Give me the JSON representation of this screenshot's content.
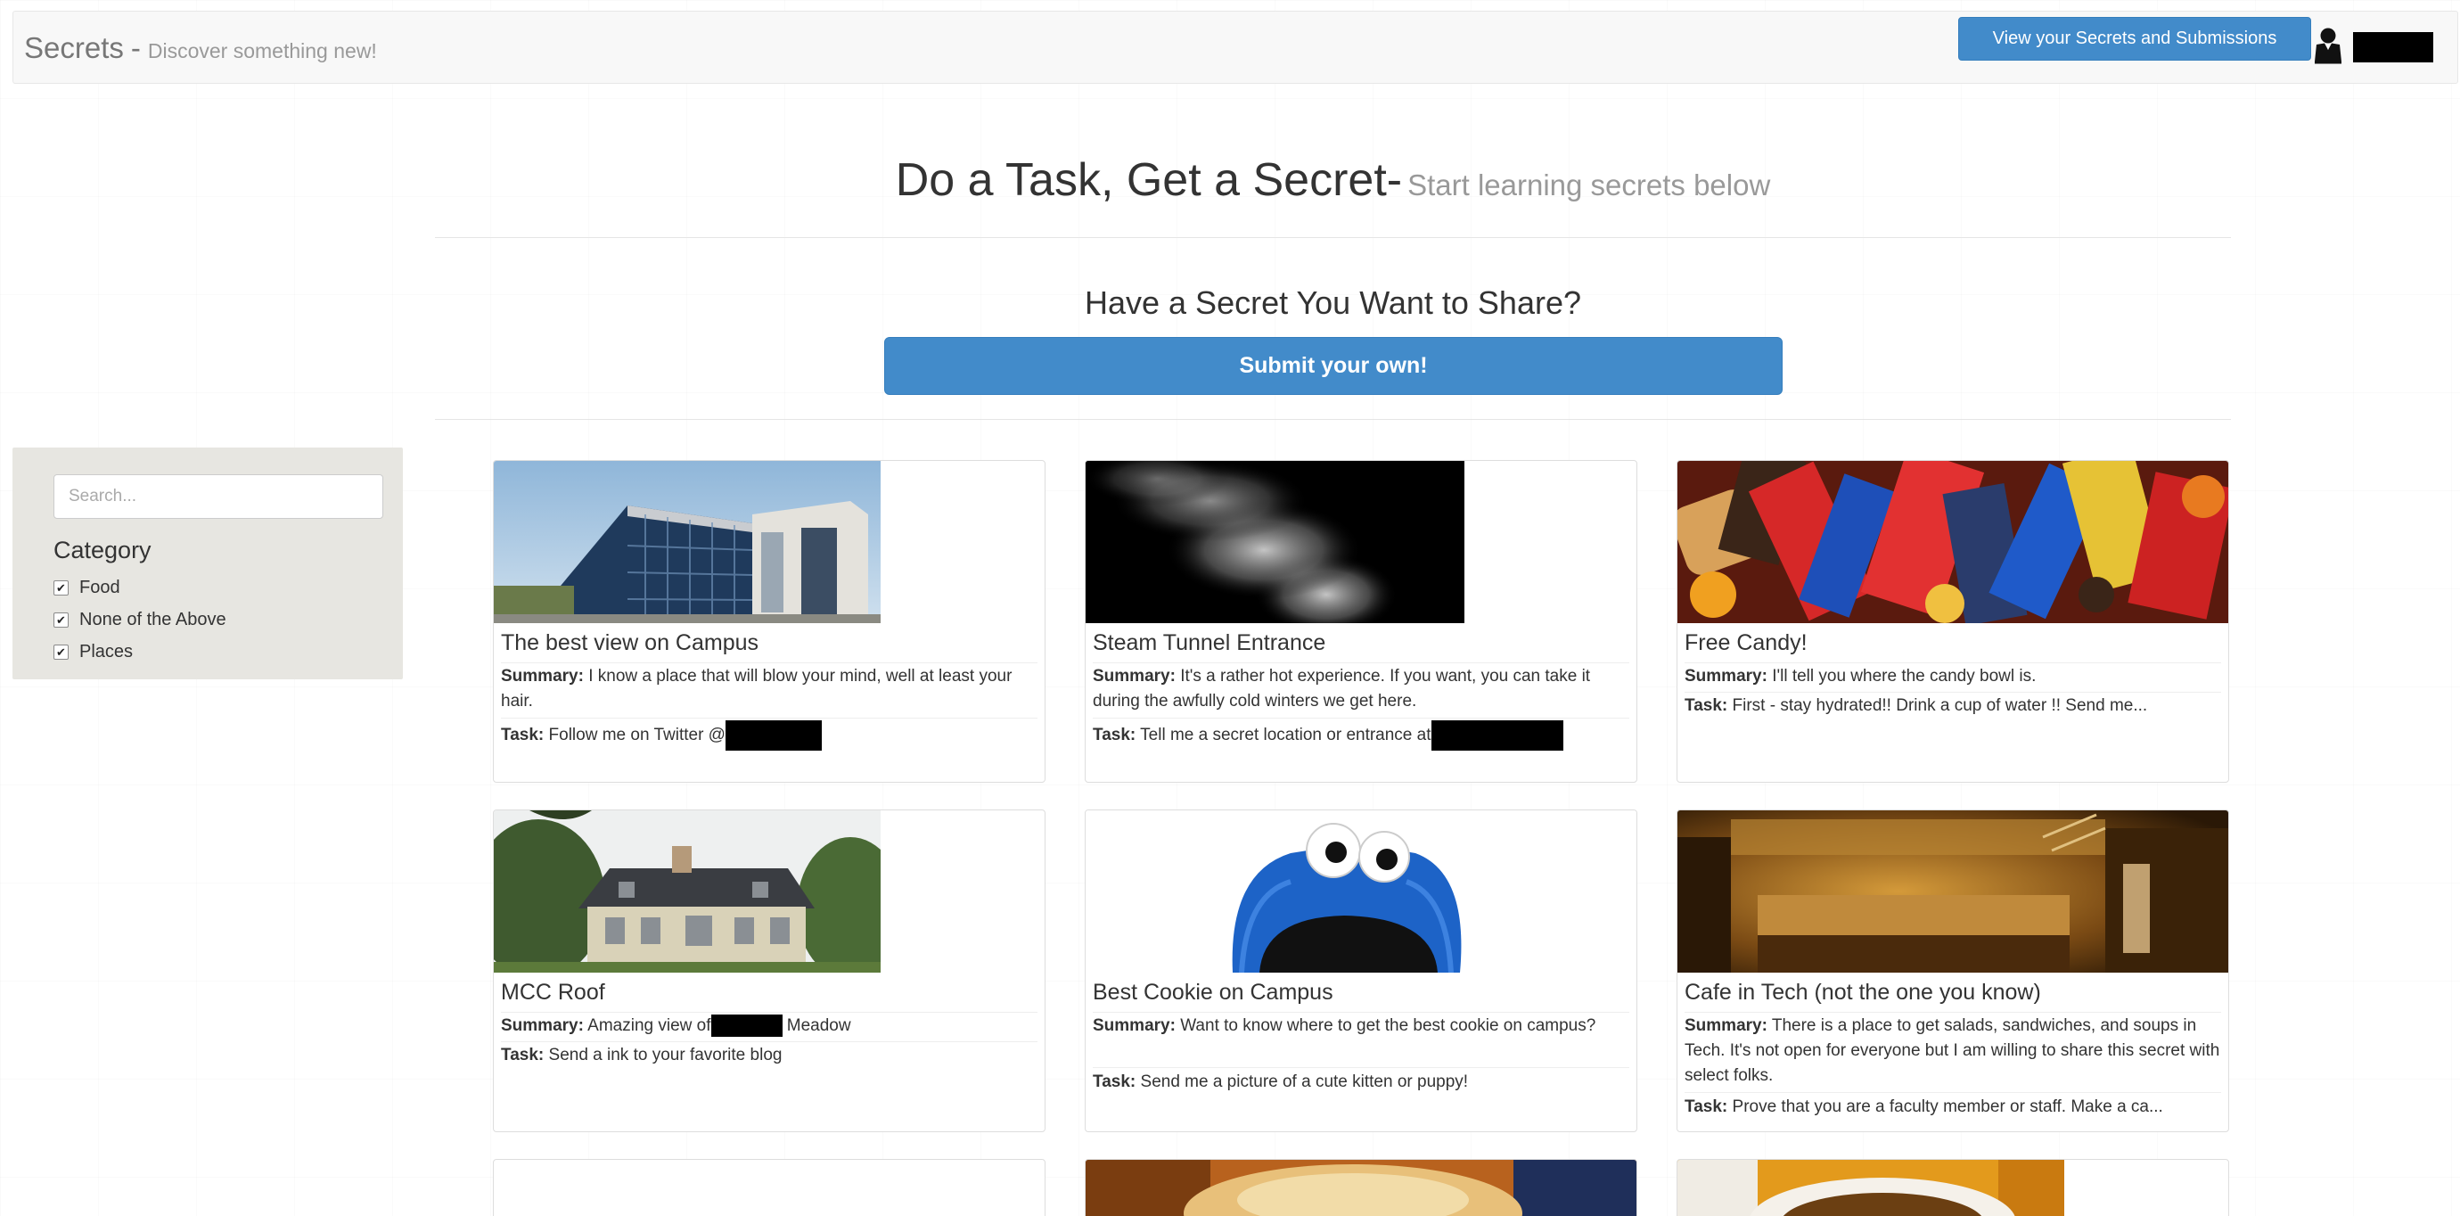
{
  "navbar": {
    "brand_title": "Secrets",
    "brand_dash": "-",
    "brand_subtitle": "Discover something new!",
    "view_button": "View your Secrets and Submissions",
    "user_icon": "user-silhouette-icon"
  },
  "header": {
    "title": "Do a Task, Get a Secret-",
    "subtitle": "Start learning secrets below",
    "share_title": "Have a Secret You Want to Share?",
    "submit_button": "Submit your own!"
  },
  "sidebar": {
    "search_placeholder": "Search...",
    "category_title": "Category",
    "categories": [
      {
        "label": "Food",
        "checked": true
      },
      {
        "label": "None of the Above",
        "checked": true
      },
      {
        "label": "Places",
        "checked": true
      }
    ]
  },
  "labels": {
    "summary": "Summary:",
    "task": "Task:"
  },
  "cards": [
    {
      "title": "The best view on Campus",
      "summary": "I know a place that will blow your mind, well at least your hair.",
      "task": "Follow me on Twitter @",
      "image": "campus-building-photo"
    },
    {
      "title": "Steam Tunnel Entrance",
      "summary": "It's a rather hot experience. If you want, you can take it during the awfully cold winters we get here.",
      "task": "Tell me a secret location or entrance at",
      "image": "steam-photo"
    },
    {
      "title": "Free Candy!",
      "summary": "I'll tell you where the candy bowl is.",
      "task": "First - stay hydrated!! Drink a cup of water !! Send me...",
      "image": "candy-photo"
    },
    {
      "title": "MCC Roof",
      "summary_before": "Amazing view of",
      "summary_after": "Meadow",
      "task": "Send a ink to your favorite blog",
      "image": "house-photo"
    },
    {
      "title": "Best Cookie on Campus",
      "summary": "Want to know where to get the best cookie on campus?",
      "task": "Send me a picture of a cute kitten or puppy!",
      "image": "cookie-monster-photo"
    },
    {
      "title": "Cafe in Tech (not the one you know)",
      "summary": "There is a place to get salads, sandwiches, and soups in Tech. It's not open for everyone but I am willing to share this secret with select folks.",
      "task": "Prove that you are a faculty member or staff. Make a ca...",
      "image": "cafe-interior-photo"
    }
  ],
  "colors": {
    "primary": "#428bca",
    "navbar_bg": "#f8f8f8",
    "sidebar_bg": "#e7e6e1",
    "muted_text": "#999999"
  }
}
